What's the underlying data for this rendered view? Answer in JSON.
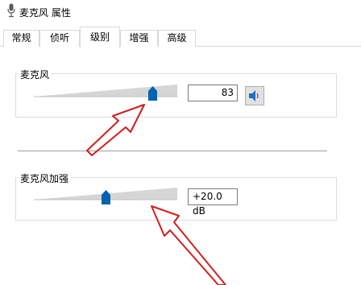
{
  "window": {
    "title": "麦克风 属性",
    "icon": "microphone-icon"
  },
  "tabs": [
    {
      "label": "常规",
      "active": false
    },
    {
      "label": "侦听",
      "active": false
    },
    {
      "label": "级别",
      "active": true
    },
    {
      "label": "增强",
      "active": false
    },
    {
      "label": "高级",
      "active": false
    }
  ],
  "microphone": {
    "label": "麦克风",
    "value": "83",
    "level_fraction": 0.83,
    "mute_icon": "speaker-icon"
  },
  "boost": {
    "label": "麦克风加强",
    "value": "+20.0 dB",
    "level_fraction": 0.5
  },
  "colors": {
    "thumb": "#0063b1",
    "annotation_arrow": "#d21f1f"
  }
}
